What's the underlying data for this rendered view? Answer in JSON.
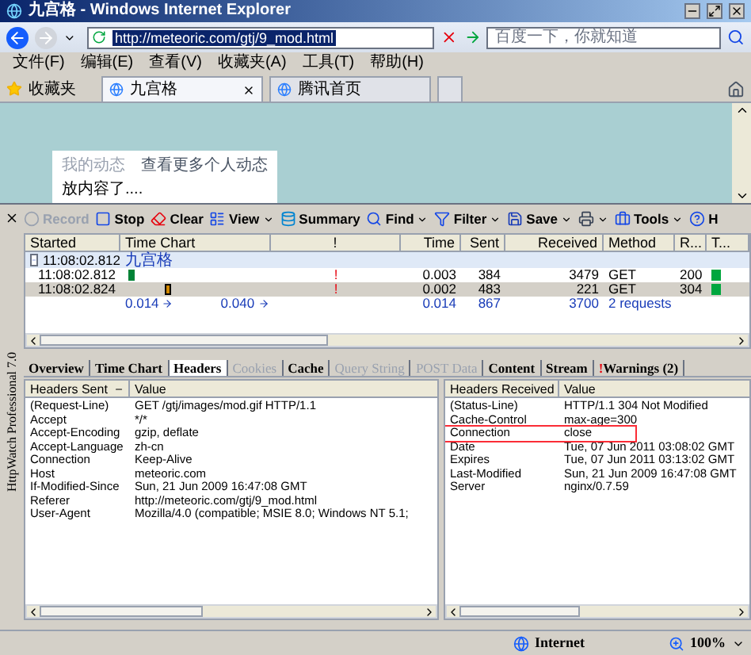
{
  "window": {
    "title": "九宫格 - Windows Internet Explorer"
  },
  "address_bar": {
    "url": "http://meteoric.com/gtj/9_mod.html",
    "placeholder": "百度一下，你就知道"
  },
  "menu": [
    "文件(F)",
    "编辑(E)",
    "查看(V)",
    "收藏夹(A)",
    "工具(T)",
    "帮助(H)"
  ],
  "favorites": {
    "label": "收藏夹"
  },
  "tabs": [
    {
      "label": "九宫格",
      "selected": true
    },
    {
      "label": "腾讯首页",
      "selected": false
    }
  ],
  "page": {
    "card": {
      "title": "我的动态",
      "link": "查看更多个人动态",
      "items": [
        "放内容了...."
      ]
    }
  },
  "httpwatch": {
    "side_label": "HttpWatch Professional 7.0",
    "toolbar": [
      {
        "kind": "record",
        "label": "Record",
        "disabled": true,
        "dropdown": false
      },
      {
        "kind": "stop",
        "label": "Stop",
        "disabled": false,
        "dropdown": false
      },
      {
        "kind": "clear",
        "label": "Clear",
        "disabled": false,
        "dropdown": false
      },
      {
        "kind": "view",
        "label": "View",
        "disabled": false,
        "dropdown": true
      },
      {
        "kind": "summary",
        "label": "Summary",
        "disabled": false,
        "dropdown": false
      },
      {
        "kind": "find",
        "label": "Find",
        "disabled": false,
        "dropdown": true
      },
      {
        "kind": "filter",
        "label": "Filter",
        "disabled": false,
        "dropdown": true
      },
      {
        "kind": "save",
        "label": "Save",
        "disabled": false,
        "dropdown": true
      },
      {
        "kind": "print",
        "disabled": false,
        "dropdown": true
      },
      {
        "kind": "tools",
        "label": "Tools",
        "disabled": false,
        "dropdown": true
      },
      {
        "kind": "help",
        "label": "H",
        "disabled": false,
        "dropdown": false
      }
    ],
    "columns": [
      "Started",
      "Time Chart",
      "!",
      "Time",
      "Sent",
      "Received",
      "Method",
      "R...",
      "T..."
    ],
    "rows": [
      {
        "kind": "group",
        "started": "11:08:02.812",
        "label": "九宫格",
        "expanded": true,
        "selected": false
      },
      {
        "kind": "request",
        "started": "11:08:02.812",
        "warning": "!",
        "time": "0.003",
        "sent": "384",
        "received": "3479",
        "method": "GET",
        "result": "200",
        "selected": false
      },
      {
        "kind": "request",
        "started": "11:08:02.824",
        "warning": "!",
        "time": "0.002",
        "sent": "483",
        "received": "221",
        "method": "GET",
        "result": "304",
        "selected": true
      },
      {
        "kind": "summary",
        "chart_start": "0.014",
        "chart_end": "0.040",
        "time": "0.014",
        "sent": "867",
        "received": "3700",
        "method": "2 requests"
      }
    ],
    "detail_tabs": [
      {
        "label": "Overview",
        "selected": false,
        "disabled": false
      },
      {
        "label": "Time Chart",
        "selected": false,
        "disabled": false
      },
      {
        "label": "Headers",
        "selected": true,
        "disabled": false
      },
      {
        "label": "Cookies",
        "selected": false,
        "disabled": true
      },
      {
        "label": "Cache",
        "selected": false,
        "disabled": false
      },
      {
        "label": "Query String",
        "selected": false,
        "disabled": true
      },
      {
        "label": "POST Data",
        "selected": false,
        "disabled": true
      },
      {
        "label": "Content",
        "selected": false,
        "disabled": false
      },
      {
        "label": "Stream",
        "selected": false,
        "disabled": false
      },
      {
        "label": "Warnings (2)",
        "flag": "!",
        "selected": false,
        "disabled": false
      }
    ],
    "sent": {
      "columns": [
        "Headers Sent",
        "Value"
      ],
      "rows": [
        {
          "name": "(Request-Line)",
          "value": "GET /gtj/images/mod.gif HTTP/1.1",
          "highlighted": false
        },
        {
          "name": "Accept",
          "value": "*/*",
          "highlighted": false
        },
        {
          "name": "Accept-Encoding",
          "value": "gzip, deflate",
          "highlighted": false
        },
        {
          "name": "Accept-Language",
          "value": "zh-cn",
          "highlighted": false
        },
        {
          "name": "Connection",
          "value": "Keep-Alive",
          "highlighted": false
        },
        {
          "name": "Host",
          "value": "meteoric.com",
          "highlighted": false
        },
        {
          "name": "If-Modified-Since",
          "value": "Sun, 21 Jun 2009 16:47:08 GMT",
          "highlighted": false
        },
        {
          "name": "Referer",
          "value": "http://meteoric.com/gtj/9_mod.html",
          "highlighted": false
        },
        {
          "name": "User-Agent",
          "value": "Mozilla/4.0 (compatible; MSIE 8.0; Windows NT 5.1;",
          "highlighted": false
        }
      ]
    },
    "received": {
      "columns": [
        "Headers Received",
        "Value"
      ],
      "rows": [
        {
          "name": "(Status-Line)",
          "value": "HTTP/1.1 304 Not Modified",
          "highlighted": false
        },
        {
          "name": "Cache-Control",
          "value": "max-age=300",
          "highlighted": false
        },
        {
          "name": "Connection",
          "value": "close",
          "highlighted": true
        },
        {
          "name": "Date",
          "value": "Tue, 07 Jun 2011 03:08:02 GMT",
          "highlighted": false
        },
        {
          "name": "Expires",
          "value": "Tue, 07 Jun 2011 03:13:02 GMT",
          "highlighted": false
        },
        {
          "name": "Last-Modified",
          "value": "Sun, 21 Jun 2009 16:47:08 GMT",
          "highlighted": false
        },
        {
          "name": "Server",
          "value": "nginx/0.7.59",
          "highlighted": false
        }
      ]
    }
  },
  "status_bar": {
    "zone": "Internet",
    "zoom": "100%"
  }
}
